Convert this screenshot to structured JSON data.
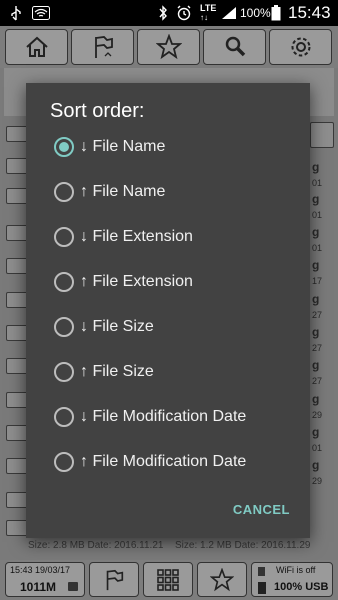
{
  "status_bar": {
    "network": "LTE",
    "battery": "100%",
    "time": "15:43"
  },
  "top_toolbar": {
    "buttons": [
      "home-icon",
      "flag-icon",
      "star-icon",
      "search-icon",
      "gear-icon"
    ]
  },
  "background_list": {
    "right_column_fragments": [
      "g",
      "01",
      "g",
      "01",
      "g",
      "01",
      "g",
      "17",
      "g",
      "27",
      "g",
      "27",
      "g",
      "27",
      "g",
      "29",
      "g",
      "01",
      "g",
      "29"
    ],
    "footer_left": "Size: 2.8 MB Date: 2016.11.21",
    "footer_right": "Size: 1.2 MB Date: 2016.11.29"
  },
  "dialog": {
    "title": "Sort order:",
    "options": [
      {
        "label": "↓ File Name",
        "selected": true
      },
      {
        "label": "↑ File Name",
        "selected": false
      },
      {
        "label": "↓ File Extension",
        "selected": false
      },
      {
        "label": "↑ File Extension",
        "selected": false
      },
      {
        "label": "↓ File Size",
        "selected": false
      },
      {
        "label": "↑ File Size",
        "selected": false
      },
      {
        "label": "↓ File Modification Date",
        "selected": false
      },
      {
        "label": "↑ File Modification Date",
        "selected": false
      }
    ],
    "cancel_label": "CANCEL"
  },
  "bottom_bar": {
    "datetime": "15:43 19/03/17",
    "storage": "1011M",
    "wifi_status": "WiFi is off",
    "battery_usb": "100% USB"
  },
  "colors": {
    "accent": "#80cbc4",
    "dialog_bg": "#424242"
  }
}
